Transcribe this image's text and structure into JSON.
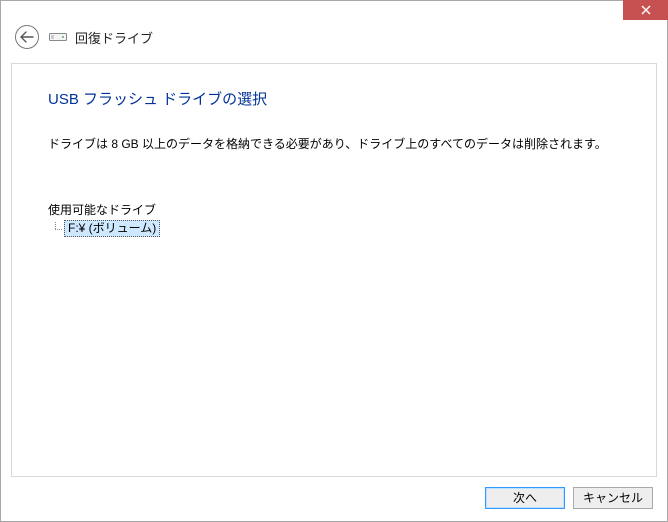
{
  "header": {
    "title": "回復ドライブ"
  },
  "main": {
    "title": "USB フラッシュ ドライブの選択",
    "description": "ドライブは 8 GB 以上のデータを格納できる必要があり、ドライブ上のすべてのデータは削除されます。",
    "list_label": "使用可能なドライブ",
    "drives": [
      {
        "label": "F:¥ (ボリューム)"
      }
    ]
  },
  "footer": {
    "next": "次へ",
    "cancel": "キャンセル"
  }
}
